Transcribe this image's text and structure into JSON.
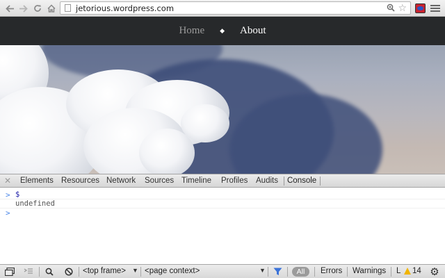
{
  "browser": {
    "url": "jetorious.wordpress.com",
    "icons": {
      "back": "arrow-left-icon",
      "forward": "arrow-right-icon",
      "reload": "reload-icon",
      "home": "home-icon",
      "page": "page-icon",
      "zoom": "zoom-icon",
      "bookmark": "star-icon",
      "extension": "extension-icon",
      "menu": "menu-icon"
    }
  },
  "site": {
    "nav": [
      {
        "label": "Home"
      },
      {
        "label": "About"
      }
    ],
    "separator": "◆"
  },
  "devtools": {
    "tabs": [
      "Elements",
      "Resources",
      "Network",
      "Sources",
      "Timeline",
      "Profiles",
      "Audits",
      "Console"
    ],
    "active_tab": "Console",
    "console": {
      "lines": [
        {
          "prompt": ">",
          "text": "$"
        },
        {
          "prompt": "",
          "text": "undefined"
        },
        {
          "prompt": ">",
          "text": ""
        }
      ]
    },
    "status": {
      "frame_select": "<top frame>",
      "context_select": "<page context>",
      "filter_all": "All",
      "errors": "Errors",
      "warnings": "Warnings",
      "logs_abbrev": "L",
      "warning_count": "14"
    }
  },
  "colors": {
    "site_header": "#27292b",
    "nav_home": "#9b9b9b",
    "nav_active": "#ffffff",
    "console_prompt": "#4a86e8",
    "warning": "#f0b400",
    "filter_icon": "#3b73d9"
  }
}
